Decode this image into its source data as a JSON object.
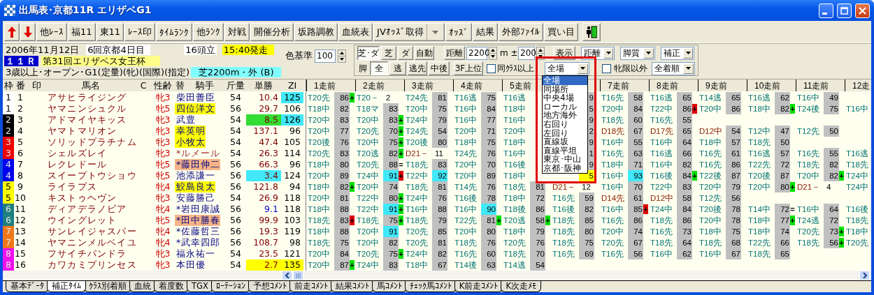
{
  "window": {
    "title": "出馬表･京都11R エリザベG1"
  },
  "toolbar": [
    {
      "kind": "up"
    },
    {
      "kind": "down"
    },
    {
      "kind": "text",
      "label": "他ﾚｰｽ"
    },
    {
      "kind": "text",
      "label": "福11"
    },
    {
      "kind": "text",
      "label": "東11"
    },
    {
      "kind": "text",
      "label": "ﾚｰｽ印"
    },
    {
      "kind": "text",
      "label": "ﾀｲﾑﾗﾝｸ"
    },
    {
      "kind": "text",
      "label": "他ﾗﾝｸ"
    },
    {
      "kind": "text",
      "label": "対戦"
    },
    {
      "kind": "text",
      "label": "開催分析"
    },
    {
      "kind": "text",
      "label": "坂路調教"
    },
    {
      "kind": "text",
      "label": "血統表"
    },
    {
      "kind": "split",
      "label": "JVｵｯｽﾞ取得"
    },
    {
      "kind": "text",
      "label": "ｵｯｽﾞ"
    },
    {
      "kind": "text",
      "label": "結果"
    },
    {
      "kind": "text",
      "label": "外部ﾌｧｲﾙ"
    },
    {
      "kind": "text",
      "label": "買い目"
    },
    {
      "kind": "exit"
    }
  ],
  "race_info": {
    "date": "2006年11月12日",
    "meeting": "6回京都4日目",
    "runners": "16頭立",
    "post_time": "15:40発走",
    "race_no": "１１Ｒ",
    "race_name": "第31回エリザベス女王杯",
    "conditions": "3歳以上･オープン･G1(定量)(牝)(国際)(指定)",
    "course": "芝2200m・外 (B)"
  },
  "color_base": {
    "label": "色基準",
    "value": "100"
  },
  "filters": {
    "surface_buttons": [
      {
        "label": "芝･ダ",
        "selected": true
      },
      {
        "label": "芝",
        "selected": false
      },
      {
        "label": "ダ",
        "selected": false
      },
      {
        "label": "自動",
        "selected": false
      }
    ],
    "distance": {
      "label": "距離",
      "value": "2200"
    },
    "range": {
      "label": "m ±",
      "value": "200"
    },
    "display": {
      "label": "表示",
      "combos": [
        "距離",
        "脚質",
        "補正"
      ]
    },
    "style_label": "脚",
    "style_buttons": [
      {
        "label": "全",
        "selected": true
      },
      {
        "label": "逃",
        "selected": false
      },
      {
        "label": "逃先",
        "selected": false
      },
      {
        "label": "中後",
        "selected": false
      }
    ],
    "top3f": "3F上位",
    "same_class": {
      "label": "同ｸﾗｽ以上",
      "checked": false
    },
    "venue": "全場",
    "non_filly": {
      "label": "牝限以外",
      "checked": false
    },
    "finish": "全着順"
  },
  "venue_list": [
    {
      "label": "全場",
      "selected": true
    },
    {
      "label": "同場所",
      "selected": false
    },
    {
      "label": "中央4場",
      "selected": false
    },
    {
      "label": "ローカル",
      "selected": false
    },
    {
      "label": "地方海外",
      "selected": false
    },
    {
      "label": "右回り",
      "selected": false
    },
    {
      "label": "左回り",
      "selected": false
    },
    {
      "label": "直線坂",
      "selected": false
    },
    {
      "label": "直線平坦",
      "selected": false
    },
    {
      "label": "東京･中山",
      "selected": false
    },
    {
      "label": "京都･阪神",
      "selected": false
    }
  ],
  "table": {
    "columns": [
      "枠",
      "番",
      "印",
      "馬名",
      "C",
      "性齢",
      "替",
      "騎手",
      "斤量",
      "単勝",
      "ZI"
    ],
    "past_columns_before": [
      "1走前",
      "2走前",
      "3走前",
      "4走前",
      "5走前"
    ],
    "past_columns_after": [
      "7走前",
      "8走前",
      "9走前",
      "10走前",
      "11走前",
      "12走"
    ],
    "rows": [
      {
        "frame": {
          "label": "1",
          "color": "#ffffff"
        },
        "number": "1",
        "name": "アサヒライジング",
        "sex_age": "牝3",
        "jockey": {
          "name": "柴田善臣",
          "kind": "regular"
        },
        "weight": "54",
        "odds": {
          "value": "10.4",
          "kind": "normal"
        },
        "zi": {
          "value": "125",
          "color": "#40e8f8"
        },
        "races": [
          {
            "race": "T20先",
            "kind": "turf",
            "score": "86",
            "shaded": true,
            "mark": {
              "symbol": "+",
              "color": "#00e000"
            }
          },
          {
            "race": "T20－",
            "kind": "turf",
            "score": "2",
            "shaded": false
          },
          {
            "race": "T24先",
            "kind": "turf",
            "score": "81",
            "shaded": true
          },
          {
            "race": "T16逃",
            "kind": "turf",
            "score": "75",
            "shaded": true
          },
          {
            "race": "T16逃",
            "kind": "turf"
          },
          {
            "score": "9",
            "shaded": true
          },
          {
            "race": "T16先",
            "kind": "turf",
            "score": "58",
            "shaded": true
          },
          {
            "race": "T16逃",
            "kind": "turf",
            "score": "65",
            "shaded": true
          },
          {
            "race": "T14逃",
            "kind": "turf",
            "score": "65",
            "shaded": true
          },
          {
            "race": "T16逃",
            "kind": "turf",
            "score": "62",
            "shaded": true
          },
          {
            "race": "T16中",
            "kind": "turf",
            "score": "49",
            "shaded": true
          }
        ]
      },
      {
        "frame": {
          "label": "1",
          "color": "#ffffff"
        },
        "number": "2",
        "name": "ヤマニンシュクル",
        "sex_age": "牝5",
        "jockey": {
          "name": "四位洋文",
          "kind": "regular",
          "color": "#ffff00"
        },
        "weight": "56",
        "odds": {
          "value": "29.7",
          "kind": "normal"
        },
        "zi": {
          "value": "106"
        },
        "races": [
          {
            "race": "T18中",
            "kind": "turf",
            "score": "82",
            "shaded": true
          },
          {
            "race": "T18マ",
            "kind": "turf",
            "score": "83",
            "shaded": true
          },
          {
            "race": "T20中",
            "kind": "turf",
            "score": "75",
            "shaded": true
          },
          {
            "race": "T16中",
            "kind": "turf",
            "score": "84",
            "shaded": true
          },
          {
            "race": "T18中",
            "kind": "turf"
          },
          {
            "score": "5",
            "shaded": true
          },
          {
            "race": "T20中",
            "kind": "turf",
            "score": "84",
            "shaded": true
          },
          {
            "race": "T22中",
            "kind": "turf",
            "score": "86",
            "shaded": true,
            "mark": {
              "symbol": "+",
              "color": "#e00000"
            }
          },
          {
            "race": "T20中",
            "kind": "turf",
            "score": "86",
            "shaded": true
          },
          {
            "race": "T18中",
            "kind": "turf",
            "score": "82",
            "shaded": true,
            "mark": {
              "symbol": "+",
              "color": "#00e000"
            }
          },
          {
            "race": "T24後",
            "kind": "turf",
            "score": "75",
            "shaded": true
          },
          {
            "race": "T16中",
            "kind": "turf"
          }
        ]
      },
      {
        "frame": {
          "label": "2",
          "color": "#000000"
        },
        "number": "3",
        "name": "アドマイヤキッス",
        "sex_age": "牝3",
        "jockey": {
          "name": "武豊",
          "kind": "regular"
        },
        "weight": "54",
        "odds": {
          "value": "8.5",
          "kind": "normal",
          "color": "#33dd33"
        },
        "zi": {
          "value": "126",
          "color": "#40e8f8"
        },
        "races": [
          {
            "race": "T20中",
            "kind": "turf",
            "score": "83",
            "shaded": true
          },
          {
            "race": "T20中",
            "kind": "turf",
            "score": "83",
            "shaded": true,
            "mark": {
              "symbol": "+",
              "color": "#00e000"
            }
          },
          {
            "race": "T24中",
            "kind": "turf",
            "score": "79",
            "shaded": true
          },
          {
            "race": "T16中",
            "kind": "turf",
            "score": "77",
            "shaded": true
          },
          {
            "race": "T16中",
            "kind": "turf"
          },
          {
            "score": "9",
            "shaded": true
          },
          {
            "race": "T18先",
            "kind": "turf",
            "score": "60",
            "shaded": true
          },
          {
            "race": "T16先",
            "kind": "turf",
            "score": "55",
            "shaded": true
          }
        ]
      },
      {
        "frame": {
          "label": "2",
          "color": "#000000"
        },
        "number": "4",
        "name": "ヤマトマリオン",
        "sex_age": "牝3",
        "jockey": {
          "name": "幸英明",
          "kind": "regular",
          "color": "#ffff00"
        },
        "weight": "54",
        "odds": {
          "value": "137.1",
          "kind": "normal"
        },
        "zi": {
          "value": "96"
        },
        "races": [
          {
            "race": "T20中",
            "kind": "turf",
            "score": "77",
            "shaded": true
          },
          {
            "race": "T20先",
            "kind": "turf",
            "score": "70",
            "shaded": true,
            "mark": {
              "symbol": "+",
              "color": "#00e000"
            }
          },
          {
            "race": "T24先",
            "kind": "turf",
            "score": "54",
            "shaded": true
          },
          {
            "race": "T20中",
            "kind": "turf",
            "score": "71",
            "shaded": true
          },
          {
            "race": "T20中",
            "kind": "turf"
          },
          {
            "score": "2",
            "shaded": true
          },
          {
            "race": "D18先",
            "kind": "dirt",
            "score": "67",
            "shaded": true
          },
          {
            "race": "D17先",
            "kind": "dirt",
            "score": "65",
            "shaded": true
          },
          {
            "race": "D12中",
            "kind": "dirt",
            "score": "54",
            "shaded": true
          },
          {
            "race": "T12中",
            "kind": "turf",
            "score": "47",
            "shaded": true
          },
          {
            "race": "T12先",
            "kind": "turf",
            "score": "50",
            "shaded": true
          }
        ]
      },
      {
        "frame": {
          "label": "3",
          "color": "#ee0000"
        },
        "number": "5",
        "name": "ソリッドプラチナム",
        "sex_age": "牝3",
        "jockey": {
          "name": "小牧太",
          "kind": "regular",
          "color": "#ffff00"
        },
        "weight": "54",
        "odds": {
          "value": "47.4",
          "kind": "normal"
        },
        "zi": {
          "value": "105"
        },
        "races": [
          {
            "race": "T20後",
            "kind": "turf",
            "score": "76",
            "shaded": true
          },
          {
            "race": "T20中",
            "kind": "turf",
            "score": "75",
            "shaded": true,
            "mark": {
              "symbol": "+",
              "color": "#00e000"
            }
          },
          {
            "race": "T20後",
            "kind": "turf",
            "score": "80",
            "shaded": true
          },
          {
            "race": "T18中",
            "kind": "turf",
            "score": "75",
            "shaded": true
          },
          {
            "race": "T18中",
            "kind": "turf"
          },
          {
            "score": "9",
            "shaded": true
          },
          {
            "race": "T16中",
            "kind": "turf",
            "score": "55",
            "shaded": true
          },
          {
            "race": "T16中",
            "kind": "turf",
            "score": "64",
            "shaded": true
          },
          {
            "race": "T18中",
            "kind": "turf",
            "score": "57",
            "shaded": true
          },
          {
            "race": "T18先",
            "kind": "turf",
            "score": "50",
            "shaded": true
          }
        ]
      },
      {
        "frame": {
          "label": "3",
          "color": "#ee0000"
        },
        "number": "6",
        "name": "シェルズレイ",
        "sex_age": "牝3",
        "jockey": {
          "name": "*ルメール",
          "kind": "guest"
        },
        "weight": "54",
        "odds": {
          "value": "26.3",
          "kind": "normal"
        },
        "zi": {
          "value": "114"
        },
        "races": [
          {
            "race": "T20先",
            "kind": "turf",
            "score": "83",
            "shaded": true
          },
          {
            "race": "T20逃",
            "kind": "turf",
            "score": "82",
            "shaded": true,
            "mark": {
              "symbol": "+",
              "color": "#00e000"
            }
          },
          {
            "race": "D21－",
            "kind": "dirt",
            "score": "11",
            "shaded": false
          },
          {
            "race": "T24先",
            "kind": "turf",
            "score": "76",
            "shaded": true
          },
          {
            "race": "T16中",
            "kind": "turf"
          },
          {
            "score": "1",
            "shaded": true
          },
          {
            "race": "T16先",
            "kind": "turf",
            "score": "63",
            "shaded": true
          },
          {
            "race": "T16逃",
            "kind": "turf",
            "score": "66",
            "shaded": true
          },
          {
            "race": "T16先",
            "kind": "turf",
            "score": "61",
            "shaded": true
          },
          {
            "race": "T16逃",
            "kind": "turf",
            "score": "57",
            "shaded": true
          },
          {
            "race": "T16先",
            "kind": "turf",
            "score": "55",
            "shaded": true
          },
          {
            "race": "T16逃",
            "kind": "turf"
          }
        ]
      },
      {
        "frame": {
          "label": "4",
          "color": "#0000ee"
        },
        "number": "7",
        "name": "レクレドール",
        "sex_age": "牝5",
        "jockey": {
          "name": "*藤田伸二",
          "kind": "regular",
          "color": "#f4b488"
        },
        "weight": "56",
        "odds": {
          "value": "66.3",
          "kind": "normal"
        },
        "zi": {
          "value": "96"
        },
        "races": [
          {
            "race": "T18中",
            "kind": "turf",
            "score": "80",
            "shaded": true
          },
          {
            "race": "T20先",
            "kind": "turf",
            "score": "88",
            "shaded": true,
            "mark": {
              "symbol": "="
            }
          },
          {
            "race": "T18先",
            "kind": "turf",
            "score": "83",
            "shaded": true
          },
          {
            "race": "T20中",
            "kind": "turf",
            "score": "70",
            "shaded": true
          },
          {
            "race": "T16後",
            "kind": "turf"
          },
          {
            "score": "9",
            "shaded": true
          },
          {
            "race": "T18中",
            "kind": "turf",
            "score": "71",
            "shaded": true
          },
          {
            "race": "T16中",
            "kind": "turf",
            "score": "82",
            "shaded": true
          },
          {
            "race": "T16先",
            "kind": "turf",
            "score": "86",
            "shaded": true
          },
          {
            "race": "T22先",
            "kind": "turf",
            "score": "72",
            "shaded": true
          },
          {
            "race": "T18先",
            "kind": "turf",
            "score": "82",
            "shaded": true
          },
          {
            "race": "T18先",
            "kind": "turf"
          }
        ]
      },
      {
        "frame": {
          "label": "4",
          "color": "#0000ee"
        },
        "number": "8",
        "name": "スイープトウショウ",
        "sex_age": "牝5",
        "jockey": {
          "name": "池添謙一",
          "kind": "regular"
        },
        "weight": "56",
        "odds": {
          "value": "3.4",
          "kind": "normal",
          "color": "#40e8f8"
        },
        "zi": {
          "value": "124"
        },
        "races": [
          {
            "race": "T20中",
            "kind": "turf",
            "score": "89",
            "shaded": true
          },
          {
            "race": "T24中",
            "kind": "turf",
            "score": "91",
            "shaded": true,
            "color": "#40e8f8",
            "mark": {
              "symbol": "+",
              "color": "#e00000"
            }
          },
          {
            "race": "T22中",
            "kind": "turf",
            "score": "92",
            "shaded": true,
            "color": "#40e8f8"
          },
          {
            "race": "T20中",
            "kind": "turf",
            "score": "89",
            "shaded": true
          },
          {
            "race": "T18中",
            "kind": "turf"
          },
          {
            "score": "5",
            "shaded": true,
            "color": "#ffff00"
          },
          {
            "race": "T16中",
            "kind": "turf",
            "score": "93",
            "shaded": true,
            "color": "#40e8f8"
          },
          {
            "race": "T16後",
            "kind": "turf",
            "score": "84",
            "shaded": true,
            "mark": {
              "symbol": "+",
              "color": "#00e000"
            }
          },
          {
            "race": "T22後",
            "kind": "turf",
            "score": "87",
            "shaded": true
          },
          {
            "race": "T20後",
            "kind": "turf",
            "score": "87",
            "shaded": true
          },
          {
            "race": "T20中",
            "kind": "turf",
            "score": "82",
            "shaded": true,
            "mark": {
              "symbol": "+",
              "color": "#00e000"
            }
          },
          {
            "race": "T24中",
            "kind": "turf"
          }
        ]
      },
      {
        "frame": {
          "label": "5",
          "color": "#ffff00"
        },
        "number": "9",
        "name": "ライラプス",
        "sex_age": "牝4",
        "jockey": {
          "name": "鮫島良太",
          "kind": "regular",
          "color": "#ffff00"
        },
        "weight": "56",
        "odds": {
          "value": "121.8",
          "kind": "normal"
        },
        "zi": {
          "value": "94"
        },
        "races": [
          {
            "race": "T18中",
            "kind": "turf",
            "score": "82",
            "shaded": true,
            "mark": {
              "symbol": "+",
              "color": "#00e000"
            }
          },
          {
            "race": "T20中",
            "kind": "turf",
            "score": "74",
            "shaded": true
          },
          {
            "race": "T18先",
            "kind": "turf",
            "score": "81",
            "shaded": true
          },
          {
            "race": "T14先",
            "kind": "turf",
            "score": "76",
            "shaded": true
          },
          {
            "race": "T18先",
            "kind": "turf",
            "score": "81",
            "shaded": true
          },
          {
            "race": "D21－",
            "kind": "dirt",
            "score": "12",
            "shaded": false
          },
          {
            "race": "T16中",
            "kind": "turf",
            "score": "70",
            "shaded": true
          },
          {
            "race": "T22中",
            "kind": "turf",
            "score": "83",
            "shaded": true
          },
          {
            "race": "T20中",
            "kind": "turf",
            "score": "79",
            "shaded": true
          },
          {
            "race": "T20中",
            "kind": "turf",
            "score": "80",
            "shaded": true,
            "mark": {
              "symbol": "+",
              "color": "#00e000"
            }
          },
          {
            "race": "D21－",
            "kind": "dirt",
            "score": "4",
            "shaded": false
          },
          {
            "race": "T24中",
            "kind": "turf"
          }
        ]
      },
      {
        "frame": {
          "label": "5",
          "color": "#ffff00"
        },
        "number": "10",
        "name": "キストゥヘヴン",
        "sex_age": "牝3",
        "jockey": {
          "name": "安藤勝己",
          "kind": "regular"
        },
        "weight": "54",
        "odds": {
          "value": "26.9",
          "kind": "normal"
        },
        "zi": {
          "value": "118"
        },
        "races": [
          {
            "race": "T20中",
            "kind": "turf",
            "score": "81",
            "shaded": true
          },
          {
            "race": "T22中",
            "kind": "turf",
            "score": "80",
            "shaded": true,
            "mark": {
              "symbol": "+",
              "color": "#00e000"
            }
          },
          {
            "race": "T24中",
            "kind": "turf",
            "score": "76",
            "shaded": true
          },
          {
            "race": "T16後",
            "kind": "turf",
            "score": "78",
            "shaded": true
          },
          {
            "race": "T18中",
            "kind": "turf",
            "score": "72",
            "shaded": true
          },
          {
            "race": "T16先",
            "kind": "turf",
            "score": "59",
            "shaded": true
          },
          {
            "race": "D14先",
            "kind": "dirt",
            "score": "61",
            "shaded": true
          },
          {
            "race": "D12中",
            "kind": "dirt",
            "score": "58",
            "shaded": true
          },
          {
            "race": "T12先",
            "kind": "turf",
            "score": "56",
            "shaded": true
          }
        ]
      },
      {
        "frame": {
          "label": "6",
          "color": "#1e7f7f"
        },
        "number": "11",
        "name": "ディアデラノビア",
        "sex_age": "牝4",
        "jockey": {
          "name": "*岩田康誠",
          "kind": "regular"
        },
        "weight": "56",
        "odds": {
          "value": "9.1",
          "kind": "alt"
        },
        "zi": {
          "value": "118"
        },
        "races": [
          {
            "race": "T18中",
            "kind": "turf",
            "score": "88",
            "shaded": true
          },
          {
            "race": "T22中",
            "kind": "turf",
            "score": "91",
            "shaded": true,
            "color": "#40e8f8",
            "mark": {
              "symbol": "+",
              "color": "#00e000"
            }
          },
          {
            "race": "T16中",
            "kind": "turf",
            "score": "88",
            "shaded": true
          },
          {
            "race": "T16中",
            "kind": "turf",
            "score": "90",
            "shaded": true,
            "color": "#40e8f8"
          },
          {
            "race": "T18後",
            "kind": "turf",
            "score": "86",
            "shaded": true
          },
          {
            "race": "T16後",
            "kind": "turf",
            "score": "82",
            "shaded": true
          },
          {
            "race": "T16中",
            "kind": "turf",
            "score": "85",
            "shaded": true,
            "mark": {
              "symbol": "+",
              "color": "#e00000"
            }
          },
          {
            "race": "T24中",
            "kind": "turf",
            "score": "84",
            "shaded": true
          },
          {
            "race": "T20後",
            "kind": "turf",
            "score": "78",
            "shaded": true
          },
          {
            "race": "T14中",
            "kind": "turf",
            "score": "72",
            "shaded": true,
            "mark": {
              "symbol": "="
            }
          },
          {
            "race": "T16中",
            "kind": "turf",
            "score": "64",
            "shaded": true
          },
          {
            "race": "T16後",
            "kind": "turf"
          }
        ]
      },
      {
        "frame": {
          "label": "6",
          "color": "#1e7f7f"
        },
        "number": "12",
        "name": "ウイングレット",
        "sex_age": "牝5",
        "jockey": {
          "name": "*田中勝春",
          "kind": "regular",
          "color": "#f4b488"
        },
        "weight": "56",
        "odds": {
          "value": "99.9",
          "kind": "normal"
        },
        "zi": {
          "value": "103"
        },
        "races": [
          {
            "race": "T18先",
            "kind": "turf",
            "score": "83",
            "shaded": true,
            "mark": {
              "symbol": "+",
              "color": "#e00000"
            }
          },
          {
            "race": "T18先",
            "kind": "turf",
            "score": "75",
            "shaded": true,
            "mark": {
              "symbol": "+",
              "color": "#00e000"
            }
          },
          {
            "race": "T18先",
            "kind": "turf",
            "score": "79",
            "shaded": true
          },
          {
            "race": "T22先",
            "kind": "turf",
            "score": "81",
            "shaded": true,
            "mark": {
              "symbol": "+",
              "color": "#00e000"
            }
          },
          {
            "race": "T20逃",
            "kind": "turf",
            "score": "58",
            "shaded": true,
            "mark": {
              "symbol": "+",
              "color": "#00e000"
            }
          },
          {
            "race": "T18先",
            "kind": "turf",
            "score": "85",
            "shaded": true
          },
          {
            "race": "T16先",
            "kind": "turf",
            "score": "86",
            "shaded": true
          },
          {
            "race": "T18先",
            "kind": "turf",
            "score": "86",
            "shaded": true
          },
          {
            "race": "T20中",
            "kind": "turf",
            "score": "78",
            "shaded": true
          },
          {
            "race": "T18中",
            "kind": "turf",
            "score": "77",
            "shaded": true,
            "mark": {
              "symbol": "+",
              "color": "#00e000"
            }
          },
          {
            "race": "T24逃",
            "kind": "turf",
            "score": "72",
            "shaded": true
          },
          {
            "race": "T18先",
            "kind": "turf"
          }
        ]
      },
      {
        "frame": {
          "label": "7",
          "color": "#f07818"
        },
        "number": "13",
        "name": "サンレイジャスパー",
        "sex_age": "牝4",
        "jockey": {
          "name": "*佐藤哲三",
          "kind": "regular"
        },
        "weight": "56",
        "odds": {
          "value": "19.3",
          "kind": "normal"
        },
        "zi": {
          "value": "119"
        },
        "races": [
          {
            "race": "T18中",
            "kind": "turf",
            "score": "88",
            "shaded": true
          },
          {
            "race": "T20中",
            "kind": "turf",
            "score": "91",
            "shaded": true,
            "color": "#40e8f8"
          },
          {
            "race": "T20先",
            "kind": "turf",
            "score": "85",
            "shaded": true
          },
          {
            "race": "T20中",
            "kind": "turf",
            "score": "80",
            "shaded": true
          },
          {
            "race": "T18中",
            "kind": "turf",
            "score": "79",
            "shaded": true
          },
          {
            "race": "T18先",
            "kind": "turf",
            "score": "80",
            "shaded": true
          },
          {
            "race": "T20中",
            "kind": "turf",
            "score": "74",
            "shaded": true
          },
          {
            "race": "T16先",
            "kind": "turf",
            "score": "73",
            "shaded": true
          },
          {
            "race": "T18中",
            "kind": "turf",
            "score": "75",
            "shaded": true
          },
          {
            "race": "T18中",
            "kind": "turf",
            "score": "74",
            "shaded": true
          },
          {
            "race": "T20先",
            "kind": "turf",
            "score": "73",
            "shaded": true,
            "mark": {
              "symbol": "+",
              "color": "#00e000"
            }
          },
          {
            "race": "T18中",
            "kind": "turf"
          }
        ]
      },
      {
        "frame": {
          "label": "7",
          "color": "#f07818"
        },
        "number": "14",
        "name": "ヤマニンメルベイユ",
        "sex_age": "牝4",
        "jockey": {
          "name": "*武幸四郎",
          "kind": "regular"
        },
        "weight": "56",
        "odds": {
          "value": "108.7",
          "kind": "normal"
        },
        "zi": {
          "value": "98"
        },
        "races": [
          {
            "race": "T18先",
            "kind": "turf",
            "score": "75",
            "shaded": true
          },
          {
            "race": "T20中",
            "kind": "turf",
            "score": "82",
            "shaded": true
          },
          {
            "race": "T20先",
            "kind": "turf",
            "score": "81",
            "shaded": true
          },
          {
            "race": "T18先",
            "kind": "turf",
            "score": "76",
            "shaded": true
          },
          {
            "race": "T20先",
            "kind": "turf",
            "score": "76",
            "shaded": true
          },
          {
            "race": "T18先",
            "kind": "turf",
            "score": "75",
            "shaded": true
          },
          {
            "race": "T20先",
            "kind": "turf",
            "score": "67",
            "shaded": true
          },
          {
            "race": "T18先",
            "kind": "turf",
            "score": "64",
            "shaded": true
          },
          {
            "race": "T18先",
            "kind": "turf",
            "score": "68",
            "shaded": true
          },
          {
            "race": "T22先",
            "kind": "turf",
            "score": "66",
            "shaded": true
          },
          {
            "race": "T18先",
            "kind": "turf",
            "score": "56",
            "shaded": true,
            "mark": {
              "symbol": "+",
              "color": "#00e000"
            }
          },
          {
            "race": "T20先",
            "kind": "turf"
          }
        ]
      },
      {
        "frame": {
          "label": "8",
          "color": "#ee10ee"
        },
        "number": "15",
        "name": "フサイチパンドラ",
        "sex_age": "牝3",
        "jockey": {
          "name": "福永祐一",
          "kind": "regular"
        },
        "weight": "54",
        "odds": {
          "value": "23.5",
          "kind": "normal"
        },
        "zi": {
          "value": "121"
        },
        "races": [
          {
            "race": "T20中",
            "kind": "turf",
            "score": "84",
            "shaded": true
          },
          {
            "race": "T20先",
            "kind": "turf",
            "score": "75",
            "shaded": true,
            "mark": {
              "symbol": "+",
              "color": "#00e000"
            }
          },
          {
            "race": "T24中",
            "kind": "turf",
            "score": "82",
            "shaded": true
          },
          {
            "race": "T16先",
            "kind": "turf",
            "score": "60",
            "shaded": true
          },
          {
            "race": "T18先",
            "kind": "turf",
            "score": "70",
            "shaded": true
          },
          {
            "race": "T16先",
            "kind": "turf",
            "score": "69",
            "shaded": true
          },
          {
            "race": "T16先",
            "kind": "turf",
            "score": "56",
            "shaded": true
          },
          {
            "race": "T16中",
            "kind": "turf",
            "score": "62",
            "shaded": true
          },
          {
            "race": "T16中",
            "kind": "turf",
            "score": "67",
            "shaded": true
          },
          {
            "race": "T18先",
            "kind": "turf",
            "score": "65",
            "shaded": true
          }
        ]
      },
      {
        "frame": {
          "label": "8",
          "color": "#ee10ee"
        },
        "number": "16",
        "name": "カワカミプリンセス",
        "sex_age": "牝3",
        "jockey": {
          "name": "本田優",
          "kind": "regular"
        },
        "weight": "54",
        "odds": {
          "value": "2.7",
          "kind": "normal",
          "color": "#ffff00"
        },
        "zi": {
          "value": "135",
          "color": "#ffff00"
        },
        "races": [
          {
            "race": "T20中",
            "kind": "turf",
            "score": "87",
            "shaded": true,
            "mark": {
              "symbol": "+",
              "color": "#00e000"
            }
          },
          {
            "race": "T24中",
            "kind": "turf",
            "score": "83",
            "shaded": true
          },
          {
            "race": "T18中",
            "kind": "turf",
            "score": "67",
            "shaded": true
          },
          {
            "race": "T14後",
            "kind": "turf",
            "score": "63",
            "shaded": true
          },
          {
            "race": "T14逃",
            "kind": "turf",
            "score": "54",
            "shaded": true
          }
        ]
      }
    ]
  },
  "sheet_tabs": [
    {
      "label": "基本ﾃﾞｰﾀ",
      "selected": false
    },
    {
      "label": "補正ﾀｲﾑ",
      "selected": true
    },
    {
      "label": "ｸﾗｽ別着順",
      "selected": false
    },
    {
      "label": "血統",
      "selected": false
    },
    {
      "label": "着度数",
      "selected": false
    },
    {
      "label": "TGX",
      "selected": false
    },
    {
      "label": "ﾛｰﾃｰｼｮﾝ",
      "selected": false
    },
    {
      "label": "予想ｺﾒﾝﾄ",
      "selected": false
    },
    {
      "label": "前走ｺﾒﾝﾄ",
      "selected": false
    },
    {
      "label": "結果ｺﾒﾝﾄ",
      "selected": false
    },
    {
      "label": "馬ｺﾒﾝﾄ",
      "selected": false
    },
    {
      "label": "ﾁｪｯｸ馬ｺﾒﾝﾄ",
      "selected": false
    },
    {
      "label": "K前走ｺﾒﾝﾄ",
      "selected": false
    },
    {
      "label": "K次走ﾒﾓ",
      "selected": false
    }
  ]
}
